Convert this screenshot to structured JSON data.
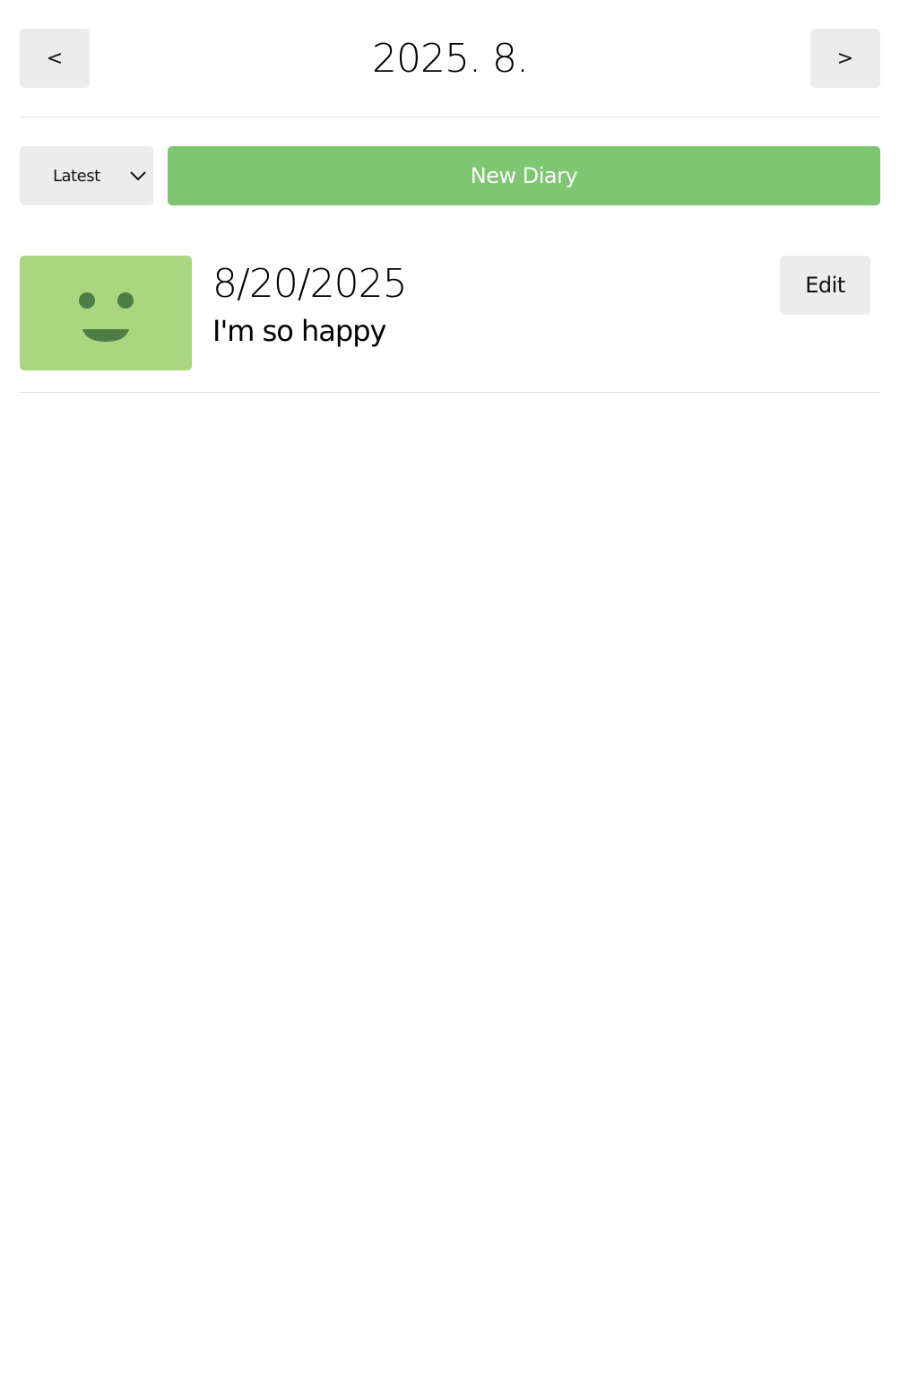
{
  "header": {
    "prev_label": "<",
    "title": "2025. 8.",
    "next_label": ">"
  },
  "toolbar": {
    "sort_selected": "Latest",
    "new_button_label": "New Diary"
  },
  "diary_list": [
    {
      "date": "8/20/2025",
      "content": "I'm so happy",
      "emotion_icon": "smile-face-icon",
      "emotion_color": "#a9d67e",
      "edit_label": "Edit"
    }
  ],
  "colors": {
    "primary_green": "#7ec670",
    "emotion_green": "#a9d67e",
    "button_gray": "#ececec",
    "face_dark_green": "#4e7e46"
  }
}
